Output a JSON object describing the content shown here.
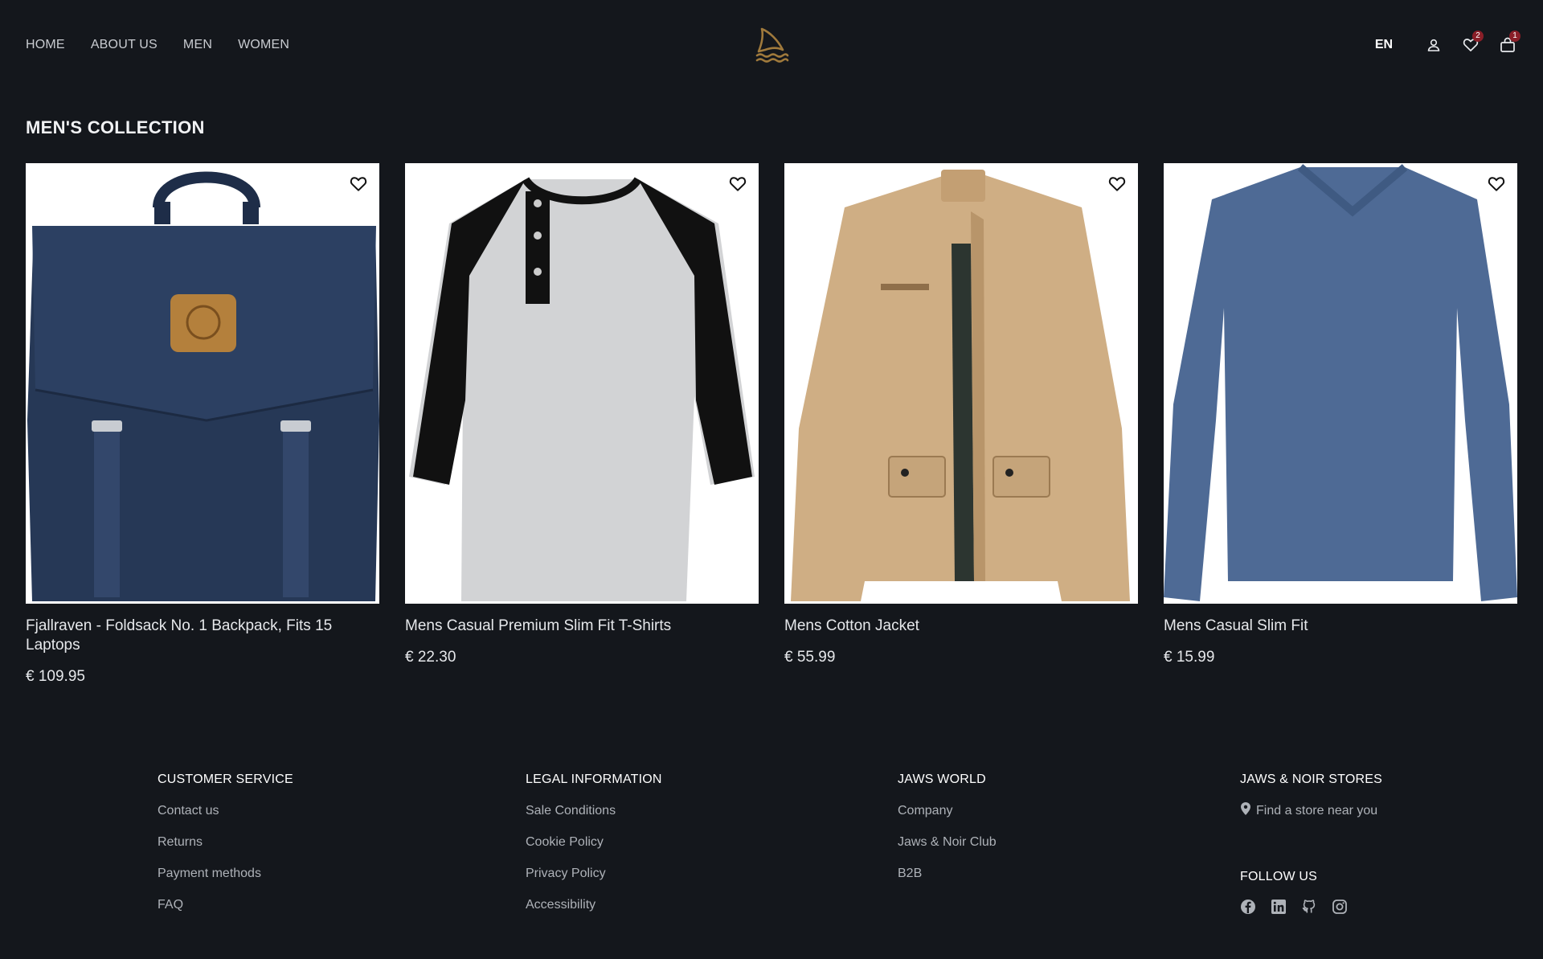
{
  "nav": {
    "items": [
      {
        "label": "HOME"
      },
      {
        "label": "ABOUT US"
      },
      {
        "label": "MEN"
      },
      {
        "label": "WOMEN"
      }
    ]
  },
  "header": {
    "logo_icon": "shark-fin-waves-logo",
    "language": "EN",
    "account_icon": "user-icon",
    "wishlist_icon": "heart-icon",
    "wishlist_count": "2",
    "cart_icon": "shopping-bag-icon",
    "cart_count": "1"
  },
  "collection": {
    "title": "MEN'S COLLECTION",
    "products": [
      {
        "name": "Fjallraven - Foldsack No. 1 Backpack, Fits 15 Laptops",
        "price": "€ 109.95",
        "image": "navy-backpack"
      },
      {
        "name": "Mens Casual Premium Slim Fit T-Shirts",
        "price": "€ 22.30",
        "image": "raglan-henley-tshirt"
      },
      {
        "name": "Mens Cotton Jacket",
        "price": "€ 55.99",
        "image": "khaki-cotton-jacket"
      },
      {
        "name": "Mens Casual Slim Fit",
        "price": "€ 15.99",
        "image": "blue-long-sleeve-tshirt"
      }
    ]
  },
  "footer": {
    "customer_service": {
      "title": "CUSTOMER SERVICE",
      "links": [
        "Contact us",
        "Returns",
        "Payment methods",
        "FAQ"
      ]
    },
    "legal": {
      "title": "LEGAL INFORMATION",
      "links": [
        "Sale Conditions",
        "Cookie Policy",
        "Privacy Policy",
        "Accessibility"
      ]
    },
    "world": {
      "title": "JAWS WORLD",
      "links": [
        "Company",
        "Jaws & Noir Club",
        "B2B"
      ]
    },
    "stores": {
      "title": "JAWS & NOIR STORES",
      "find_store": "Find a store near you",
      "follow_title": "FOLLOW US",
      "social_icons": [
        "facebook-icon",
        "linkedin-icon",
        "github-icon",
        "instagram-icon"
      ]
    }
  },
  "colors": {
    "background": "#14171c",
    "accent_logo": "#a07a3c",
    "badge": "#8a1f28"
  }
}
